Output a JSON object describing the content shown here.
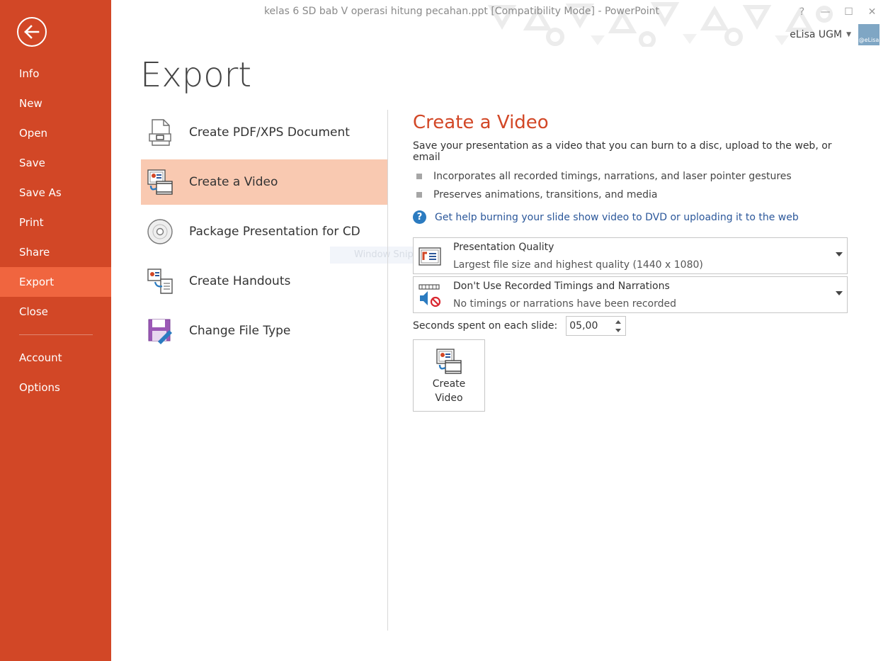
{
  "window": {
    "title": "kelas 6 SD bab V operasi hitung pecahan.ppt [Compatibility Mode] - PowerPoint",
    "help_glyph": "?",
    "minimize_glyph": "—",
    "maximize_glyph": "☐",
    "close_glyph": "✕",
    "user_name": "eLisa UGM",
    "avatar_text": "@eLisa"
  },
  "sidebar": {
    "items": [
      {
        "label": "Info"
      },
      {
        "label": "New"
      },
      {
        "label": "Open"
      },
      {
        "label": "Save"
      },
      {
        "label": "Save As"
      },
      {
        "label": "Print"
      },
      {
        "label": "Share"
      },
      {
        "label": "Export"
      },
      {
        "label": "Close"
      },
      {
        "label": "Account"
      },
      {
        "label": "Options"
      }
    ],
    "active": "Export"
  },
  "page": {
    "title": "Export"
  },
  "export_options": [
    {
      "label": "Create PDF/XPS Document",
      "icon": "pdf-document-icon"
    },
    {
      "label": "Create a Video",
      "icon": "video-icon",
      "selected": true
    },
    {
      "label": "Package Presentation for CD",
      "icon": "cd-icon"
    },
    {
      "label": "Create Handouts",
      "icon": "handouts-icon"
    },
    {
      "label": "Change File Type",
      "icon": "save-file-type-icon"
    }
  ],
  "ghost_overlay": "Window Snip",
  "panel": {
    "title": "Create a Video",
    "description": "Save your presentation as a video that you can burn to a disc, upload to the web, or email",
    "bullets": [
      "Incorporates all recorded timings, narrations, and laser pointer gestures",
      "Preserves animations, transitions, and media"
    ],
    "help_link": "Get help burning your slide show video to DVD or uploading it to the web",
    "quality": {
      "main": "Presentation Quality",
      "sub": "Largest file size and highest quality (1440 x 1080)"
    },
    "timings": {
      "main": "Don't Use Recorded Timings and Narrations",
      "sub": "No timings or narrations have been recorded"
    },
    "seconds_label": "Seconds spent on each slide:",
    "seconds_value": "05,00",
    "create_button": "Create Video"
  },
  "colors": {
    "accent": "#d24726",
    "active_nav": "#f0653f",
    "selected_option": "#f9c9b1",
    "link": "#2b579a"
  }
}
